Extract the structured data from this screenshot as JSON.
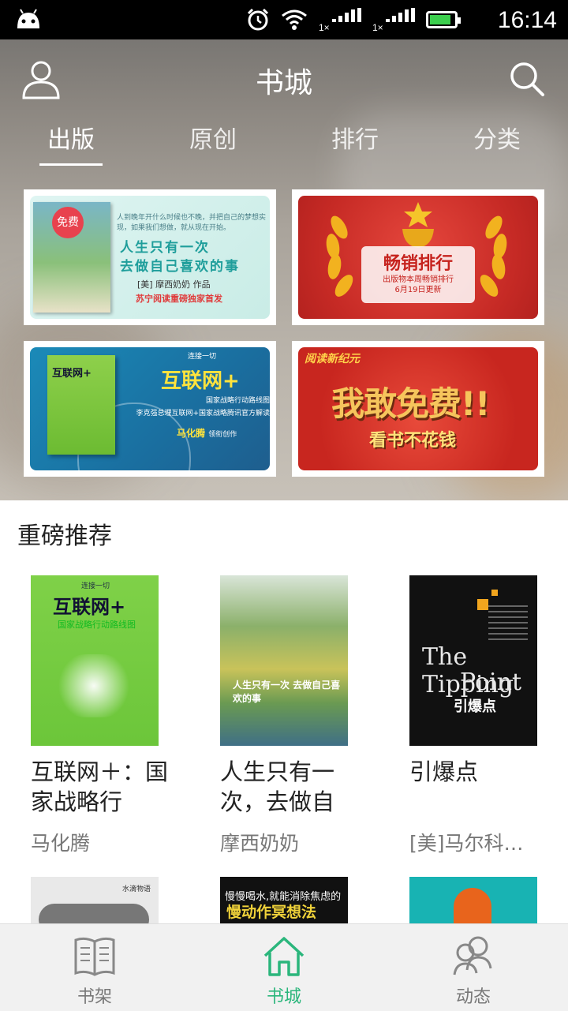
{
  "status_bar": {
    "time": "16:14",
    "sim1_label": "1×",
    "sim2_label": "1×",
    "icons": [
      "android-icon",
      "alarm-icon",
      "wifi-icon",
      "signal-icon",
      "signal-icon",
      "battery-icon"
    ],
    "battery_level": 0.85
  },
  "header": {
    "title": "书城"
  },
  "tabs": [
    {
      "label": "出版",
      "active": true
    },
    {
      "label": "原创",
      "active": false
    },
    {
      "label": "排行",
      "active": false
    },
    {
      "label": "分类",
      "active": false
    }
  ],
  "banners": {
    "b1": {
      "badge": "免费",
      "small_text": "人到晚年开什么时候也不晚，并把自己的梦想实现，如果我们想做，就从现在开始。",
      "title_line1": "人生只有一次",
      "title_line2": "去做自己喜欢的事",
      "author": "[美] 摩西奶奶 作品",
      "tagline": "苏宁阅读重磅独家首发"
    },
    "b2": {
      "title": "畅销排行",
      "subtitle": "出版物本周畅销排行",
      "update": "6月19日更新"
    },
    "b3": {
      "book_title": "互联网+",
      "top": "连接一切",
      "title": "互联网+",
      "line1": "国家战略行动路线图",
      "line2": "李克强总理互联网+国家战略腾讯官方解读",
      "author": "马化腾",
      "author_suffix": "领衔创作"
    },
    "b4": {
      "brand": "阅读新纪元",
      "title": "我敢免费!!",
      "subtitle": "看书不花钱"
    }
  },
  "section": {
    "title": "重磅推荐"
  },
  "books": [
    {
      "title": "互联网＋：国家战略行",
      "author": "马化腾",
      "cover_top": "连接一切",
      "cover_title": "互联网+",
      "cover_sub": "国家战略行动路线图"
    },
    {
      "title": "人生只有一次，去做自",
      "author": "摩西奶奶",
      "cover_title": "人生只有一次 去做自己喜欢的事"
    },
    {
      "title": "引爆点",
      "author": "[美]马尔科…",
      "cover_title1": "The Tipping",
      "cover_title2": "Point",
      "cover_cn": "引爆点"
    }
  ],
  "books_row2": [
    {
      "cover_text": "水滴物语"
    },
    {
      "cover_line1": "慢慢喝水,就能消除焦虑的",
      "cover_line2": "慢动作冥想法"
    },
    {}
  ],
  "bottom_nav": [
    {
      "label": "书架",
      "active": false,
      "icon": "bookshelf-icon"
    },
    {
      "label": "书城",
      "active": true,
      "icon": "home-icon"
    },
    {
      "label": "动态",
      "active": false,
      "icon": "friends-icon"
    }
  ],
  "colors": {
    "accent": "#2bb67c",
    "status_bar": "#000000",
    "battery_fill": "#3ccf4e"
  }
}
